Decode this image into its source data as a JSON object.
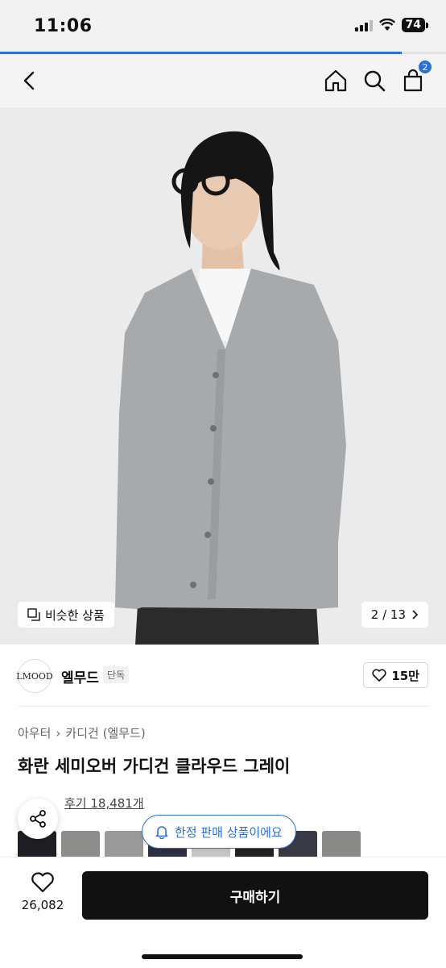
{
  "status_bar": {
    "time": "11:06",
    "battery": "74"
  },
  "page_progress": 0.9,
  "nav": {
    "cart_count": "2"
  },
  "gallery": {
    "similar_label": "비슷한 상품",
    "page_indicator": "2 / 13",
    "colors": {
      "background": "#ebebeb",
      "cardigan": "#a7aaad",
      "tshirt": "#f7f7f7",
      "pants": "#2b2b2b",
      "hair": "#151515"
    }
  },
  "brand": {
    "logo_text": "LMOOD",
    "name": "엘무드",
    "tag": "단독",
    "likes": "15만"
  },
  "product": {
    "breadcrumb": [
      "아우터",
      "카디건 (엘무드)"
    ],
    "title": "화란 세미오버 가디건 클라우드 그레이",
    "reviews": "후기 18,481개"
  },
  "limited_notice": "한정 판매 상품이에요",
  "bottom": {
    "heart_count": "26,082",
    "buy_label": "구매하기"
  },
  "thumbnail_colors": [
    "#1e1f24",
    "#8d8d8b",
    "#9a9a9a",
    "#2c3042",
    "#c7c7c7",
    "#202225",
    "#383b44",
    "#8a8a88"
  ]
}
